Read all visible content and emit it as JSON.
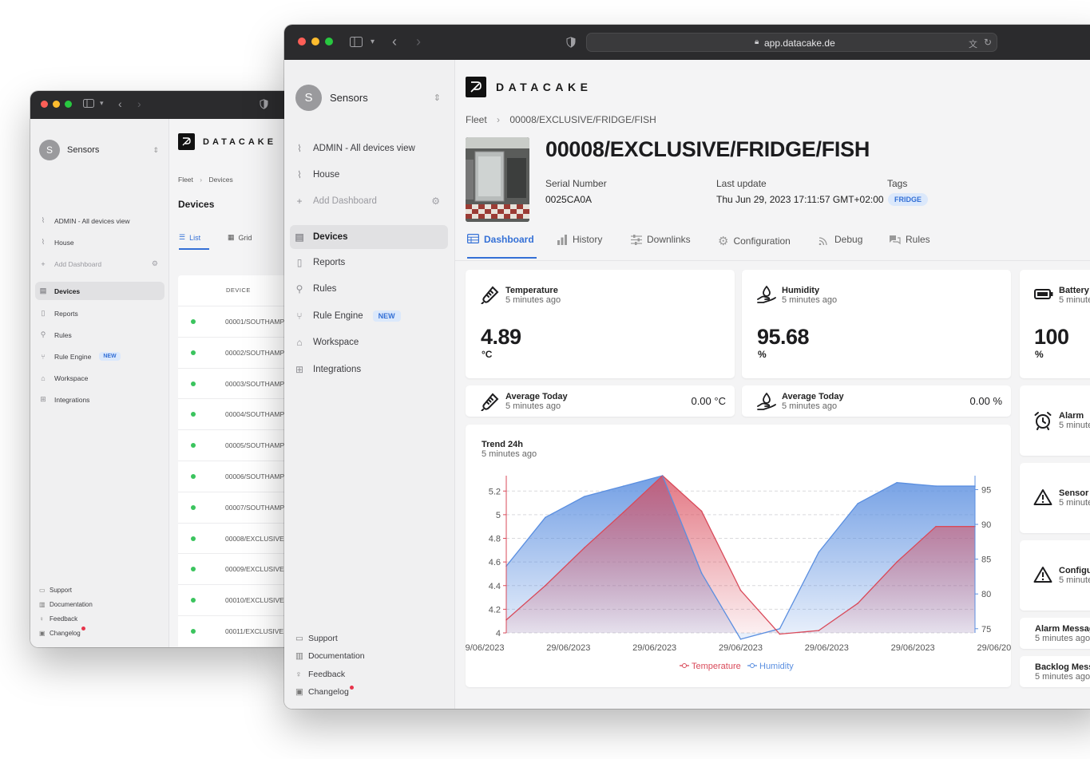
{
  "back_window": {
    "workspace": {
      "initial": "S",
      "name": "Sensors"
    },
    "logo_text": "DATACAKE",
    "breadcrumb": {
      "root": "Fleet",
      "current": "Devices"
    },
    "page_title": "Devices",
    "view_tabs": [
      {
        "label": "List"
      },
      {
        "label": "Grid"
      }
    ],
    "table_header": "DEVICE",
    "nav": [
      {
        "label": "ADMIN - All devices view"
      },
      {
        "label": "House"
      },
      {
        "label": "Add Dashboard"
      },
      {
        "label": "Devices"
      },
      {
        "label": "Reports"
      },
      {
        "label": "Rules"
      },
      {
        "label": "Rule Engine",
        "badge": "NEW"
      },
      {
        "label": "Workspace"
      },
      {
        "label": "Integrations"
      }
    ],
    "footer": [
      {
        "label": "Support"
      },
      {
        "label": "Documentation"
      },
      {
        "label": "Feedback"
      },
      {
        "label": "Changelog"
      }
    ],
    "rows": [
      "00001/SOUTHAMP",
      "00002/SOUTHAMP",
      "00003/SOUTHAMP",
      "00004/SOUTHAMP",
      "00005/SOUTHAMP",
      "00006/SOUTHAMP",
      "00007/SOUTHAMP",
      "00008/EXCLUSIVE",
      "00009/EXCLUSIVE",
      "00010/EXCLUSIVE",
      "00011/EXCLUSIVE"
    ]
  },
  "front_window": {
    "url": "app.datacake.de",
    "workspace": {
      "initial": "S",
      "name": "Sensors"
    },
    "logo_text": "DATACAKE",
    "nav": [
      {
        "label": "ADMIN - All devices view"
      },
      {
        "label": "House"
      },
      {
        "label": "Add Dashboard"
      },
      {
        "label": "Devices"
      },
      {
        "label": "Reports"
      },
      {
        "label": "Rules"
      },
      {
        "label": "Rule Engine",
        "badge": "NEW"
      },
      {
        "label": "Workspace"
      },
      {
        "label": "Integrations"
      }
    ],
    "footer": [
      {
        "label": "Support"
      },
      {
        "label": "Documentation"
      },
      {
        "label": "Feedback"
      },
      {
        "label": "Changelog"
      }
    ],
    "breadcrumb": {
      "root": "Fleet",
      "current": "00008/EXCLUSIVE/FRIDGE/FISH"
    },
    "device": {
      "title": "00008/EXCLUSIVE/FRIDGE/FISH",
      "serial_label": "Serial Number",
      "serial": "0025CA0A",
      "update_label": "Last update",
      "update": "Thu Jun 29, 2023 17:11:57 GMT+02:00",
      "tags_label": "Tags",
      "tag": "FRIDGE"
    },
    "tabs": [
      {
        "label": "Dashboard"
      },
      {
        "label": "History"
      },
      {
        "label": "Downlinks"
      },
      {
        "label": "Configuration"
      },
      {
        "label": "Debug"
      },
      {
        "label": "Rules"
      }
    ],
    "cards": {
      "temperature": {
        "title": "Temperature",
        "sub": "5 minutes ago",
        "value": "4.89",
        "unit": "°C"
      },
      "humidity": {
        "title": "Humidity",
        "sub": "5 minutes ago",
        "value": "95.68",
        "unit": "%"
      },
      "battery": {
        "title": "Battery",
        "sub": "5 minute",
        "value": "100",
        "unit": "%"
      },
      "avg_temp": {
        "title": "Average Today",
        "sub": "5 minutes ago",
        "value": "0.00",
        "unit": "°C"
      },
      "avg_hum": {
        "title": "Average Today",
        "sub": "5 minutes ago",
        "value": "0.00",
        "unit": "%"
      },
      "alarm": {
        "title": "Alarm",
        "sub": "5 minute"
      },
      "sensor": {
        "title": "Sensor I",
        "sub": "5 minute"
      },
      "config": {
        "title": "Configu",
        "sub": "5 minute"
      },
      "alarm_msg": {
        "title": "Alarm Messag",
        "sub": "5 minutes ago"
      },
      "backlog": {
        "title": "Backlog Mess",
        "sub": "5 minutes ago"
      }
    },
    "trend": {
      "title": "Trend 24h",
      "sub": "5 minutes ago"
    }
  },
  "chart_data": {
    "type": "area",
    "title": "Trend 24h",
    "subtitle": "5 minutes ago",
    "x": [
      0,
      1,
      2,
      3,
      4,
      5,
      6,
      7,
      8,
      9,
      10,
      11,
      12
    ],
    "x_tick_labels": [
      "29/06/2023",
      "29/06/2023",
      "29/06/2023",
      "29/06/2023",
      "29/06/2023",
      "29/06/2023",
      "29/06/2023"
    ],
    "series": [
      {
        "name": "Temperature",
        "axis": "left",
        "color": "#d94a5a",
        "values": [
          4.11,
          4.4,
          4.72,
          5.02,
          5.33,
          5.03,
          4.36,
          3.99,
          4.02,
          4.25,
          4.6,
          4.9,
          4.9
        ]
      },
      {
        "name": "Humidity",
        "axis": "right",
        "color": "#5b8fe0",
        "values": [
          84.0,
          91.0,
          94.0,
          95.5,
          97.0,
          83.0,
          73.5,
          75.0,
          86.0,
          93.0,
          96.0,
          95.5,
          95.5
        ]
      }
    ],
    "y_left": {
      "ticks": [
        "4",
        "4.2",
        "4.4",
        "4.6",
        "4.8",
        "5",
        "5.2"
      ],
      "range": [
        4,
        5.33
      ]
    },
    "y_right": {
      "ticks": [
        "75",
        "80",
        "85",
        "90",
        "95"
      ],
      "range": [
        74.4,
        97
      ]
    },
    "legend": "bottom-center",
    "grid": true
  }
}
